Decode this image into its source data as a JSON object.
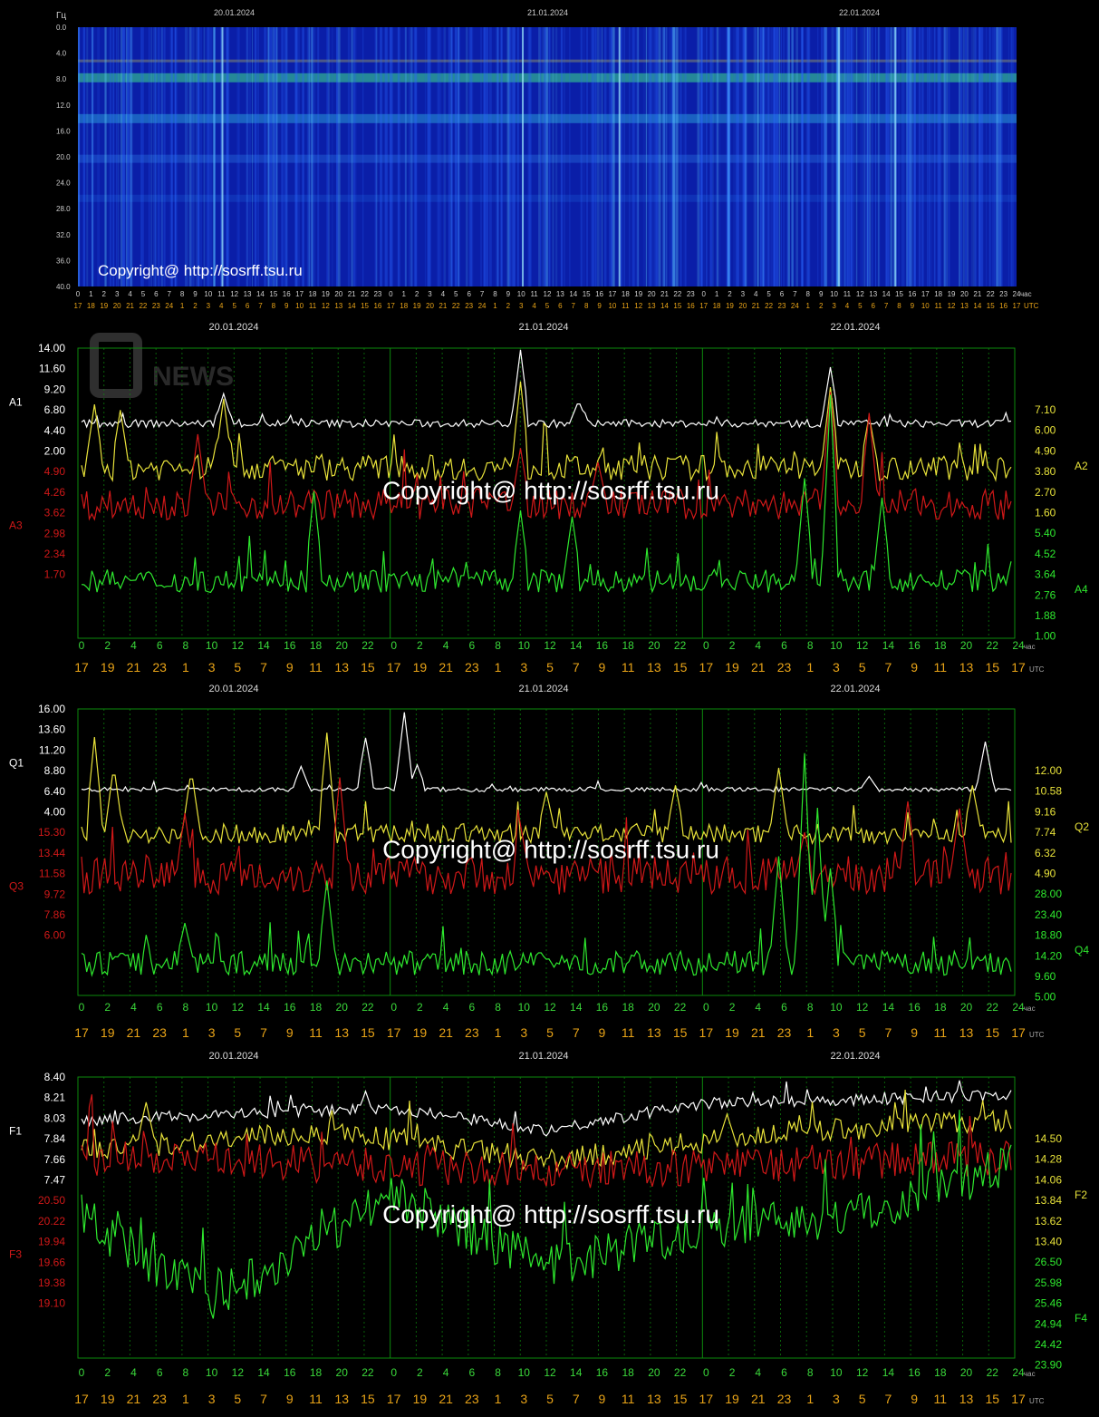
{
  "colors": {
    "white": "#ffffff",
    "yellow": "#e8e23a",
    "red": "#d01818",
    "green": "#2ee82e",
    "grid": "#0d8a0d",
    "orange": "#e8a317"
  },
  "labels": {
    "hours_label": "час",
    "utc_label": "UTC",
    "copyright": "Copyright@ http://sosrff.tsu.ru",
    "watermark": "NEWS"
  },
  "spectrogram": {
    "unit": "Гц",
    "y_ticks": [
      "0.0",
      "4.0",
      "8.0",
      "12.0",
      "16.0",
      "20.0",
      "24.0",
      "28.0",
      "32.0",
      "36.0",
      "40.0"
    ],
    "dates": [
      "20.01.2024",
      "21.01.2024",
      "22.01.2024"
    ],
    "ticks_top": [
      "0",
      "1",
      "2",
      "3",
      "4",
      "5",
      "6",
      "7",
      "8",
      "9",
      "10",
      "11",
      "12",
      "13",
      "14",
      "15",
      "16",
      "17",
      "18",
      "19",
      "20",
      "21",
      "22",
      "23",
      "0",
      "1",
      "2",
      "3",
      "4",
      "5",
      "6",
      "7",
      "8",
      "9",
      "10",
      "11",
      "12",
      "13",
      "14",
      "15",
      "16",
      "17",
      "18",
      "19",
      "20",
      "21",
      "22",
      "23",
      "0",
      "1",
      "2",
      "3",
      "4",
      "5",
      "6",
      "7",
      "8",
      "9",
      "10",
      "11",
      "12",
      "13",
      "14",
      "15",
      "16",
      "17",
      "18",
      "19",
      "20",
      "21",
      "22",
      "23",
      "24"
    ],
    "ticks_bottom": [
      "17",
      "18",
      "19",
      "20",
      "21",
      "22",
      "23",
      "24",
      "1",
      "2",
      "3",
      "4",
      "5",
      "6",
      "7",
      "8",
      "9",
      "10",
      "11",
      "12",
      "13",
      "14",
      "15",
      "16",
      "17",
      "18",
      "19",
      "20",
      "21",
      "22",
      "23",
      "24",
      "1",
      "2",
      "3",
      "4",
      "5",
      "6",
      "7",
      "8",
      "9",
      "10",
      "11",
      "12",
      "13",
      "14",
      "15",
      "16",
      "17",
      "18",
      "19",
      "20",
      "21",
      "22",
      "23",
      "24",
      "1",
      "2",
      "3",
      "4",
      "5",
      "6",
      "7",
      "8",
      "9",
      "10",
      "11",
      "12",
      "13",
      "14",
      "15",
      "16",
      "17"
    ]
  },
  "chart_data": [
    {
      "type": "line",
      "dates": [
        "20.01.2024",
        "21.01.2024",
        "22.01.2024"
      ],
      "x_ticks": [
        "0",
        "2",
        "4",
        "6",
        "8",
        "10",
        "12",
        "14",
        "16",
        "18",
        "20",
        "22",
        "0",
        "2",
        "4",
        "6",
        "8",
        "10",
        "12",
        "14",
        "16",
        "18",
        "20",
        "22",
        "0",
        "2",
        "4",
        "6",
        "8",
        "10",
        "12",
        "14",
        "16",
        "18",
        "20",
        "22",
        "24"
      ],
      "utc_ticks": [
        "17",
        "19",
        "21",
        "23",
        "1",
        "3",
        "5",
        "7",
        "9",
        "11",
        "13",
        "15",
        "17",
        "19",
        "21",
        "23",
        "1",
        "3",
        "5",
        "7",
        "9",
        "11",
        "13",
        "15",
        "17",
        "19",
        "21",
        "23",
        "1",
        "3",
        "5",
        "7",
        "9",
        "11",
        "13",
        "15",
        "17"
      ],
      "left_axes": [
        {
          "name": "A1",
          "color": "white",
          "ticks": [
            "14.00",
            "11.60",
            "9.20",
            "6.80",
            "4.40",
            "2.00"
          ]
        },
        {
          "name": "A3",
          "color": "red",
          "ticks": [
            "4.90",
            "4.26",
            "3.62",
            "2.98",
            "2.34",
            "1.70"
          ]
        }
      ],
      "right_axes": [
        {
          "name": "A2",
          "color": "yellow",
          "ticks": [
            "7.10",
            "6.00",
            "4.90",
            "3.80",
            "2.70",
            "1.60"
          ]
        },
        {
          "name": "A4",
          "color": "green",
          "ticks": [
            "5.40",
            "4.52",
            "3.64",
            "2.76",
            "1.88",
            "1.00"
          ]
        }
      ],
      "series": [
        {
          "name": "A1",
          "color": "white",
          "base": 4.6,
          "noise": 0.5,
          "spikes": [
            [
              11,
              8.4
            ],
            [
              34,
              14.0
            ],
            [
              38.5,
              7.5
            ],
            [
              58,
              11.8
            ]
          ],
          "range": [
            2.0,
            14.0
          ]
        },
        {
          "name": "A2",
          "color": "yellow",
          "base": 3.0,
          "noise": 0.45,
          "spikes": [
            [
              1,
              5.2
            ],
            [
              3,
              5.0
            ],
            [
              11,
              5.4
            ],
            [
              34,
              6.0
            ],
            [
              58,
              5.8
            ],
            [
              61,
              4.8
            ]
          ],
          "range": [
            1.6,
            7.1
          ]
        },
        {
          "name": "A3",
          "color": "red",
          "base": 2.7,
          "noise": 0.22,
          "spikes": [
            [
              9,
              3.7
            ],
            [
              34,
              3.5
            ],
            [
              40,
              3.3
            ],
            [
              58,
              4.3
            ],
            [
              61,
              4.0
            ]
          ],
          "range": [
            1.7,
            4.9
          ]
        },
        {
          "name": "A4",
          "color": "green",
          "base": 1.8,
          "noise": 0.18,
          "spikes": [
            [
              18,
              3.2
            ],
            [
              34,
              2.9
            ],
            [
              38,
              2.8
            ],
            [
              56,
              3.4
            ],
            [
              58,
              4.7
            ],
            [
              62,
              3.1
            ]
          ],
          "range": [
            1.0,
            5.4
          ]
        }
      ]
    },
    {
      "type": "line",
      "dates": [
        "20.01.2024",
        "21.01.2024",
        "22.01.2024"
      ],
      "x_ticks": [
        "0",
        "2",
        "4",
        "6",
        "8",
        "10",
        "12",
        "14",
        "16",
        "18",
        "20",
        "22",
        "0",
        "2",
        "4",
        "6",
        "8",
        "10",
        "12",
        "14",
        "16",
        "18",
        "20",
        "22",
        "0",
        "2",
        "4",
        "6",
        "8",
        "10",
        "12",
        "14",
        "16",
        "18",
        "20",
        "22",
        "24"
      ],
      "utc_ticks": [
        "17",
        "19",
        "21",
        "23",
        "1",
        "3",
        "5",
        "7",
        "9",
        "11",
        "13",
        "15",
        "17",
        "19",
        "21",
        "23",
        "1",
        "3",
        "5",
        "7",
        "9",
        "11",
        "13",
        "15",
        "17",
        "19",
        "21",
        "23",
        "1",
        "3",
        "5",
        "7",
        "9",
        "11",
        "13",
        "15",
        "17"
      ],
      "left_axes": [
        {
          "name": "Q1",
          "color": "white",
          "ticks": [
            "16.00",
            "13.60",
            "11.20",
            "8.80",
            "6.40",
            "4.00"
          ]
        },
        {
          "name": "Q3",
          "color": "red",
          "ticks": [
            "15.30",
            "13.44",
            "11.58",
            "9.72",
            "7.86",
            "6.00"
          ]
        }
      ],
      "right_axes": [
        {
          "name": "Q2",
          "color": "yellow",
          "ticks": [
            "12.00",
            "10.58",
            "9.16",
            "7.74",
            "6.32",
            "4.90"
          ]
        },
        {
          "name": "Q4",
          "color": "green",
          "ticks": [
            "28.00",
            "23.40",
            "18.80",
            "14.20",
            "9.60",
            "5.00"
          ]
        }
      ],
      "series": [
        {
          "name": "Q1",
          "color": "white",
          "base": 5.8,
          "noise": 0.3,
          "spikes": [
            [
              17,
              8.8
            ],
            [
              22,
              12.5
            ],
            [
              25,
              15.8
            ],
            [
              26,
              9.0
            ],
            [
              61,
              7.5
            ],
            [
              70,
              12.0
            ]
          ],
          "range": [
            4.0,
            16.0
          ]
        },
        {
          "name": "Q2",
          "color": "yellow",
          "base": 6.4,
          "noise": 0.45,
          "spikes": [
            [
              1,
              10.8
            ],
            [
              2.5,
              9.5
            ],
            [
              8.5,
              9.3
            ],
            [
              19,
              11.0
            ],
            [
              36,
              8.3
            ],
            [
              46,
              8.6
            ],
            [
              54,
              9.4
            ],
            [
              69,
              8.6
            ]
          ],
          "range": [
            4.9,
            12.0
          ]
        },
        {
          "name": "Q3",
          "color": "red",
          "base": 8.4,
          "noise": 0.8,
          "spikes": [
            [
              8,
              11.0
            ],
            [
              20,
              12.5
            ],
            [
              34,
              10.5
            ],
            [
              56,
              10.2
            ],
            [
              64,
              11.5
            ],
            [
              68,
              11.2
            ]
          ],
          "range": [
            6.0,
            15.3
          ]
        },
        {
          "name": "Q4",
          "color": "green",
          "base": 7.2,
          "noise": 1.0,
          "spikes": [
            [
              8,
              10.5
            ],
            [
              19,
              14.0
            ],
            [
              54,
              16.0
            ],
            [
              56,
              24.5
            ],
            [
              57,
              20.0
            ],
            [
              58,
              15.0
            ]
          ],
          "range": [
            5.0,
            28.0
          ]
        }
      ]
    },
    {
      "type": "line",
      "dates": [
        "20.01.2024",
        "21.01.2024",
        "22.01.2024"
      ],
      "x_ticks": [
        "0",
        "2",
        "4",
        "6",
        "8",
        "10",
        "12",
        "14",
        "16",
        "18",
        "20",
        "22",
        "0",
        "2",
        "4",
        "6",
        "8",
        "10",
        "12",
        "14",
        "16",
        "18",
        "20",
        "22",
        "0",
        "2",
        "4",
        "6",
        "8",
        "10",
        "12",
        "14",
        "16",
        "18",
        "20",
        "22",
        "24"
      ],
      "utc_ticks": [
        "17",
        "19",
        "21",
        "23",
        "1",
        "3",
        "5",
        "7",
        "9",
        "11",
        "13",
        "15",
        "17",
        "19",
        "21",
        "23",
        "1",
        "3",
        "5",
        "7",
        "9",
        "11",
        "13",
        "15",
        "17",
        "19",
        "21",
        "23",
        "1",
        "3",
        "5",
        "7",
        "9",
        "11",
        "13",
        "15",
        "17"
      ],
      "left_axes": [
        {
          "name": "F1",
          "color": "white",
          "ticks": [
            "8.40",
            "8.21",
            "8.03",
            "7.84",
            "7.66",
            "7.47"
          ]
        },
        {
          "name": "F3",
          "color": "red",
          "ticks": [
            "20.50",
            "20.22",
            "19.94",
            "19.66",
            "19.38",
            "19.10"
          ]
        }
      ],
      "right_axes": [
        {
          "name": "F2",
          "color": "yellow",
          "ticks": [
            "14.50",
            "14.28",
            "14.06",
            "13.84",
            "13.62",
            "13.40"
          ]
        },
        {
          "name": "F4",
          "color": "green",
          "ticks": [
            "26.50",
            "25.98",
            "25.46",
            "24.94",
            "24.42",
            "23.90"
          ]
        }
      ],
      "series": [
        {
          "name": "F1",
          "color": "white",
          "base": 7.92,
          "noise": 0.07,
          "trend": [
            [
              0,
              7.9
            ],
            [
              24,
              8.05
            ],
            [
              36,
              7.78
            ],
            [
              48,
              8.1
            ],
            [
              72,
              8.2
            ]
          ],
          "spikes": [
            [
              22,
              8.25
            ],
            [
              68,
              8.38
            ]
          ],
          "range": [
            7.3,
            8.4
          ]
        },
        {
          "name": "F2",
          "color": "yellow",
          "base": 13.95,
          "noise": 0.1,
          "trend": [
            [
              0,
              13.9
            ],
            [
              20,
              14.05
            ],
            [
              36,
              13.8
            ],
            [
              55,
              14.05
            ],
            [
              72,
              14.15
            ]
          ],
          "spikes": [
            [
              5,
              14.3
            ],
            [
              50,
              14.2
            ]
          ],
          "range": [
            13.2,
            14.5
          ]
        },
        {
          "name": "F3",
          "color": "red",
          "base": 19.95,
          "noise": 0.12,
          "trend": [
            [
              0,
              20.0
            ],
            [
              36,
              19.9
            ],
            [
              72,
              20.0
            ]
          ],
          "spikes": [],
          "range": [
            19.1,
            20.5
          ]
        },
        {
          "name": "F4",
          "color": "green",
          "base": 24.8,
          "noise": 0.22,
          "trend": [
            [
              0,
              25.2
            ],
            [
              10,
              24.4
            ],
            [
              24,
              25.4
            ],
            [
              36,
              24.7
            ],
            [
              48,
              25.1
            ],
            [
              60,
              25.2
            ],
            [
              72,
              25.7
            ]
          ],
          "spikes": [
            [
              66,
              26.0
            ]
          ],
          "range": [
            23.9,
            26.5
          ]
        }
      ]
    }
  ]
}
